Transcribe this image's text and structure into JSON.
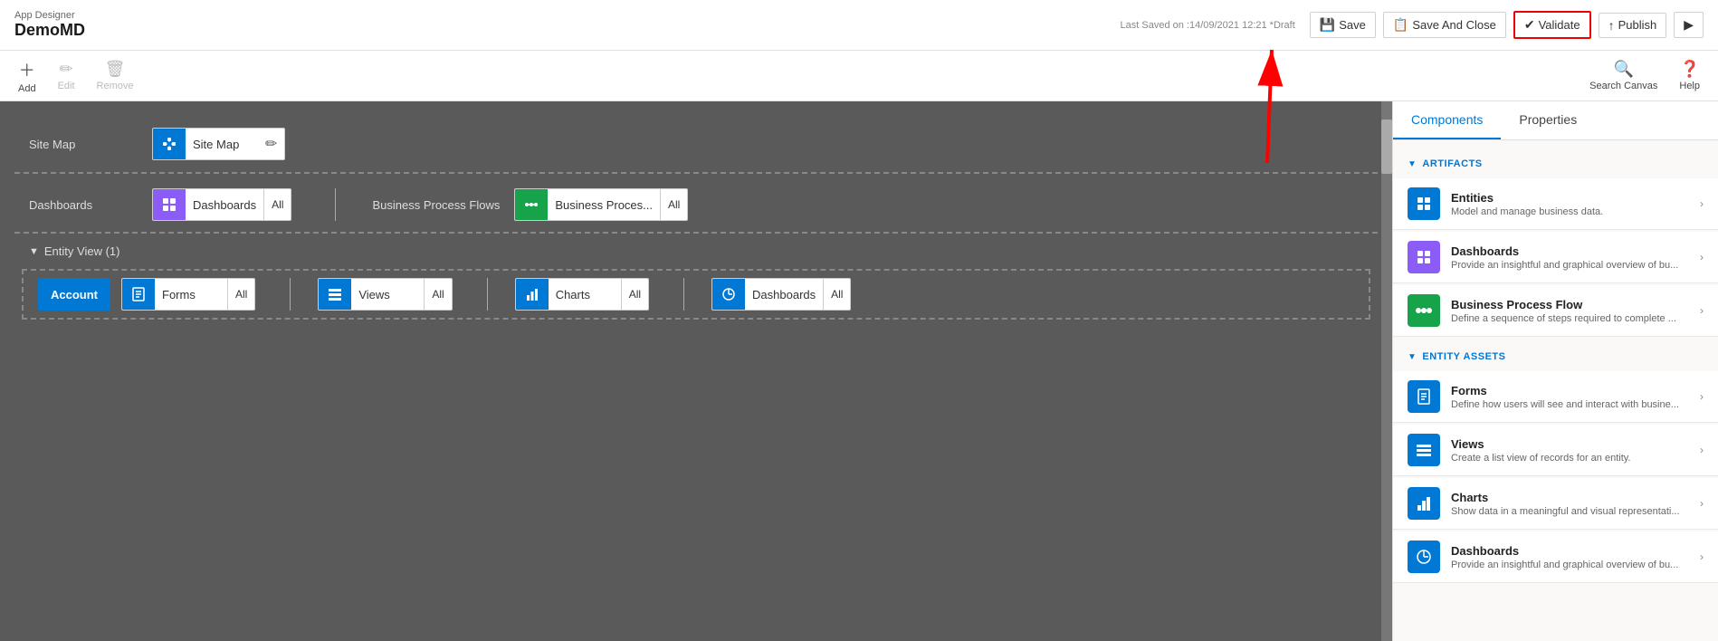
{
  "header": {
    "app_designer_label": "App Designer",
    "app_name": "DemoMD",
    "last_saved": "Last Saved on :14/09/2021 12:21 *Draft",
    "save_label": "Save",
    "save_close_label": "Save And Close",
    "validate_label": "Validate",
    "publish_label": "Publish",
    "play_label": "Play"
  },
  "toolbar": {
    "add_label": "Add",
    "edit_label": "Edit",
    "remove_label": "Remove",
    "search_canvas_label": "Search Canvas",
    "help_label": "Help"
  },
  "canvas": {
    "site_map_label": "Site Map",
    "site_map_text": "Site Map",
    "dashboards_label": "Dashboards",
    "dashboards_text": "Dashboards",
    "dashboards_all": "All",
    "bpf_label": "Business Process Flows",
    "bpf_text": "Business Proces...",
    "bpf_all": "All",
    "entity_view_label": "Entity View (1)",
    "account_label": "Account",
    "forms_text": "Forms",
    "forms_all": "All",
    "views_text": "Views",
    "views_all": "All",
    "charts_text": "Charts",
    "charts_all": "All",
    "entity_dashboards_text": "Dashboards",
    "entity_dashboards_all": "All"
  },
  "right_panel": {
    "components_tab": "Components",
    "properties_tab": "Properties",
    "artifacts_header": "ARTIFACTS",
    "entity_assets_header": "ENTITY ASSETS",
    "items": [
      {
        "id": "entities",
        "title": "Entities",
        "desc": "Model and manage business data.",
        "icon_type": "entities",
        "bg": "blue"
      },
      {
        "id": "dashboards",
        "title": "Dashboards",
        "desc": "Provide an insightful and graphical overview of bu...",
        "icon_type": "dashboard",
        "bg": "purple"
      },
      {
        "id": "bpf",
        "title": "Business Process Flow",
        "desc": "Define a sequence of steps required to complete ...",
        "icon_type": "bpf",
        "bg": "green"
      }
    ],
    "entity_assets": [
      {
        "id": "forms",
        "title": "Forms",
        "desc": "Define how users will see and interact with busine...",
        "icon_type": "forms",
        "bg": "blue"
      },
      {
        "id": "views",
        "title": "Views",
        "desc": "Create a list view of records for an entity.",
        "icon_type": "views",
        "bg": "blue"
      },
      {
        "id": "charts",
        "title": "Charts",
        "desc": "Show data in a meaningful and visual representati...",
        "icon_type": "charts",
        "bg": "blue"
      },
      {
        "id": "dashboards2",
        "title": "Dashboards",
        "desc": "Provide an insightful and graphical overview of bu...",
        "icon_type": "dashboard2",
        "bg": "blue"
      }
    ]
  }
}
